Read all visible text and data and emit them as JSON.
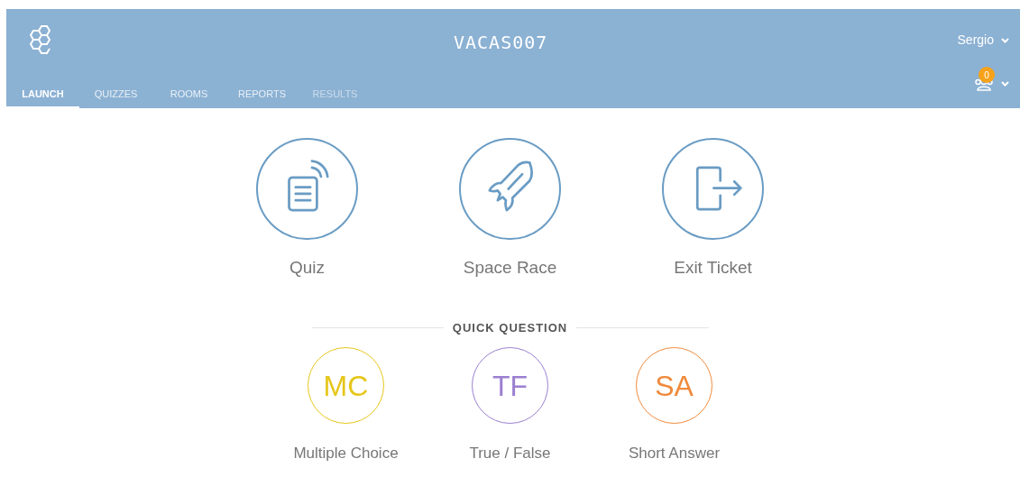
{
  "header": {
    "room": "VACAS007",
    "user": "Sergio",
    "notifications": "0"
  },
  "tabs": [
    {
      "label": "LAUNCH",
      "selected": true,
      "disabled": false
    },
    {
      "label": "QUIZZES",
      "selected": false,
      "disabled": false
    },
    {
      "label": "ROOMS",
      "selected": false,
      "disabled": false
    },
    {
      "label": "REPORTS",
      "selected": false,
      "disabled": false
    },
    {
      "label": "RESULTS",
      "selected": false,
      "disabled": true
    }
  ],
  "activities": [
    {
      "kind": "quiz",
      "label": "Quiz"
    },
    {
      "kind": "rocket",
      "label": "Space Race"
    },
    {
      "kind": "exit",
      "label": "Exit Ticket"
    }
  ],
  "quick_question": {
    "title": "QUICK QUESTION",
    "options": [
      {
        "abbr": "MC",
        "label": "Multiple Choice",
        "color": "#e6c619"
      },
      {
        "abbr": "TF",
        "label": "True / False",
        "color": "#9b7fd1"
      },
      {
        "abbr": "SA",
        "label": "Short Answer",
        "color": "#f08a3c"
      }
    ]
  }
}
